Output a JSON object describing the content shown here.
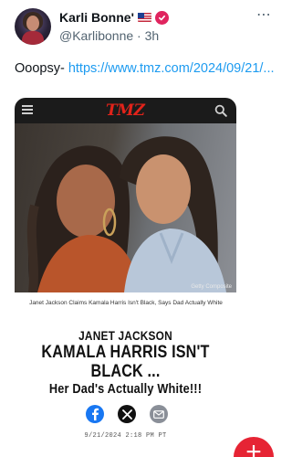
{
  "post": {
    "author_name": "Karli Bonne'",
    "flag_emoji": "US flag",
    "verified_icon": "verified-badge-icon",
    "handle": "@Karlibonne",
    "separator": "·",
    "time": "3h",
    "more_label": "⋯",
    "text_prefix": "Ooopsy- ",
    "link_text": "https://www.tmz.com/2024/09/21/...",
    "link_color": "#1d9bf0"
  },
  "card": {
    "logo": "TMZ",
    "menu_icon": "hamburger-icon",
    "search_icon": "search-icon",
    "photo_credit": "Getty Composite",
    "caption": "Janet Jackson Claims Kamala Harris Isn't Black, Says Dad Actually White",
    "headline": {
      "line1": "JANET JACKSON",
      "line2": "KAMALA HARRIS ISN'T",
      "line3": "BLACK ...",
      "line4": "Her Dad's Actually White!!!"
    },
    "share_icons": [
      "facebook-icon",
      "x-icon",
      "mail-icon"
    ],
    "date": "9/21/2024 2:18 PM PT"
  },
  "fab": {
    "label": "+",
    "color": "#e62434"
  }
}
